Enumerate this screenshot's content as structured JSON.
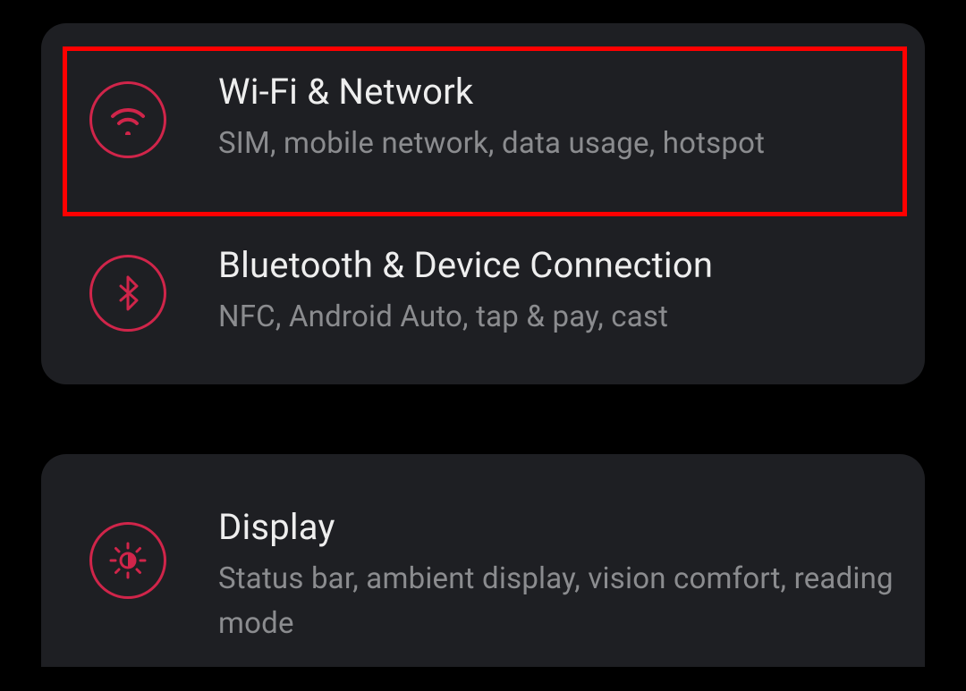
{
  "groups": [
    {
      "items": [
        {
          "key": "wifi",
          "title": "Wi-Fi & Network",
          "subtitle": "SIM, mobile network, data usage, hotspot",
          "icon": "wifi-icon",
          "highlighted": true
        },
        {
          "key": "bluetooth",
          "title": "Bluetooth & Device Connection",
          "subtitle": "NFC, Android Auto, tap & pay, cast",
          "icon": "bluetooth-icon",
          "highlighted": false
        }
      ]
    },
    {
      "items": [
        {
          "key": "display",
          "title": "Display",
          "subtitle": "Status bar, ambient display, vision comfort, reading mode",
          "icon": "brightness-icon",
          "highlighted": false
        }
      ]
    }
  ],
  "colors": {
    "accent": "#d0254a",
    "cardBg": "#1e1f23",
    "pageBg": "#000000",
    "titleColor": "#eeeeee",
    "subtitleColor": "#8b8c8f",
    "highlight": "#ff0000"
  }
}
